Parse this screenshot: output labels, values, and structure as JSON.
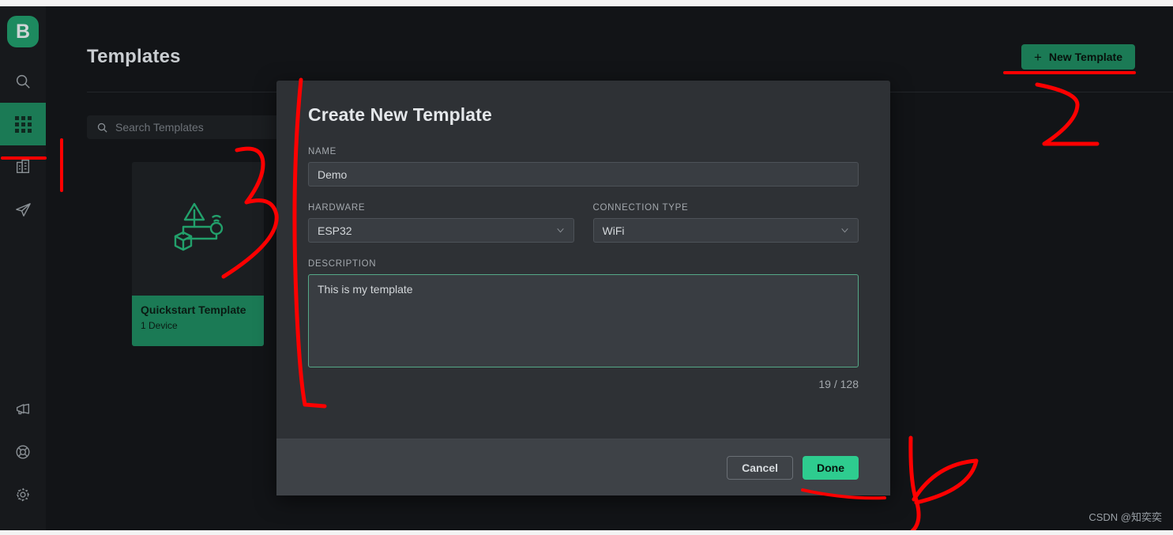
{
  "app": {
    "logo_letter": "B",
    "watermark": "CSDN @知奕奕"
  },
  "sidebar": {
    "items": [
      {
        "name": "search-icon",
        "label": "Search"
      },
      {
        "name": "templates-grid-icon",
        "label": "Templates",
        "active": true
      },
      {
        "name": "organization-building-icon",
        "label": "Organization"
      },
      {
        "name": "paper-plane-icon",
        "label": "Send"
      },
      {
        "name": "megaphone-icon",
        "label": "Announcements"
      },
      {
        "name": "lifebuoy-icon",
        "label": "Help"
      },
      {
        "name": "gear-icon",
        "label": "Settings"
      }
    ]
  },
  "header": {
    "title": "Templates",
    "new_template_button": "New Template",
    "plus_glyph": "+"
  },
  "search": {
    "placeholder": "Search Templates",
    "value": ""
  },
  "templates": [
    {
      "name": "Quickstart Template",
      "devices": "1 Device"
    }
  ],
  "modal": {
    "title": "Create New Template",
    "fields": {
      "name": {
        "label": "NAME",
        "value": "Demo",
        "placeholder": ""
      },
      "hardware": {
        "label": "HARDWARE",
        "value": "ESP32"
      },
      "connection_type": {
        "label": "CONNECTION TYPE",
        "value": "WiFi"
      },
      "description": {
        "label": "DESCRIPTION",
        "value": "This is my template",
        "counter": "19 / 128"
      }
    },
    "buttons": {
      "cancel": "Cancel",
      "done": "Done"
    }
  },
  "annotations": [
    {
      "name": "annotation-mark-1",
      "text": "1"
    },
    {
      "name": "annotation-mark-2",
      "text": "2"
    },
    {
      "name": "annotation-mark-3",
      "text": "3"
    },
    {
      "name": "annotation-mark-4",
      "text": "4"
    }
  ],
  "colors": {
    "brand_green": "#1b7a55",
    "accent_green": "#2ecc8f",
    "focus_border": "#55a887",
    "annotation_red": "#fe0000",
    "app_bg": "#121417",
    "sidebar_bg": "#17191c",
    "modal_bg": "#2e3135",
    "modal_footer_bg": "#3e4247"
  }
}
